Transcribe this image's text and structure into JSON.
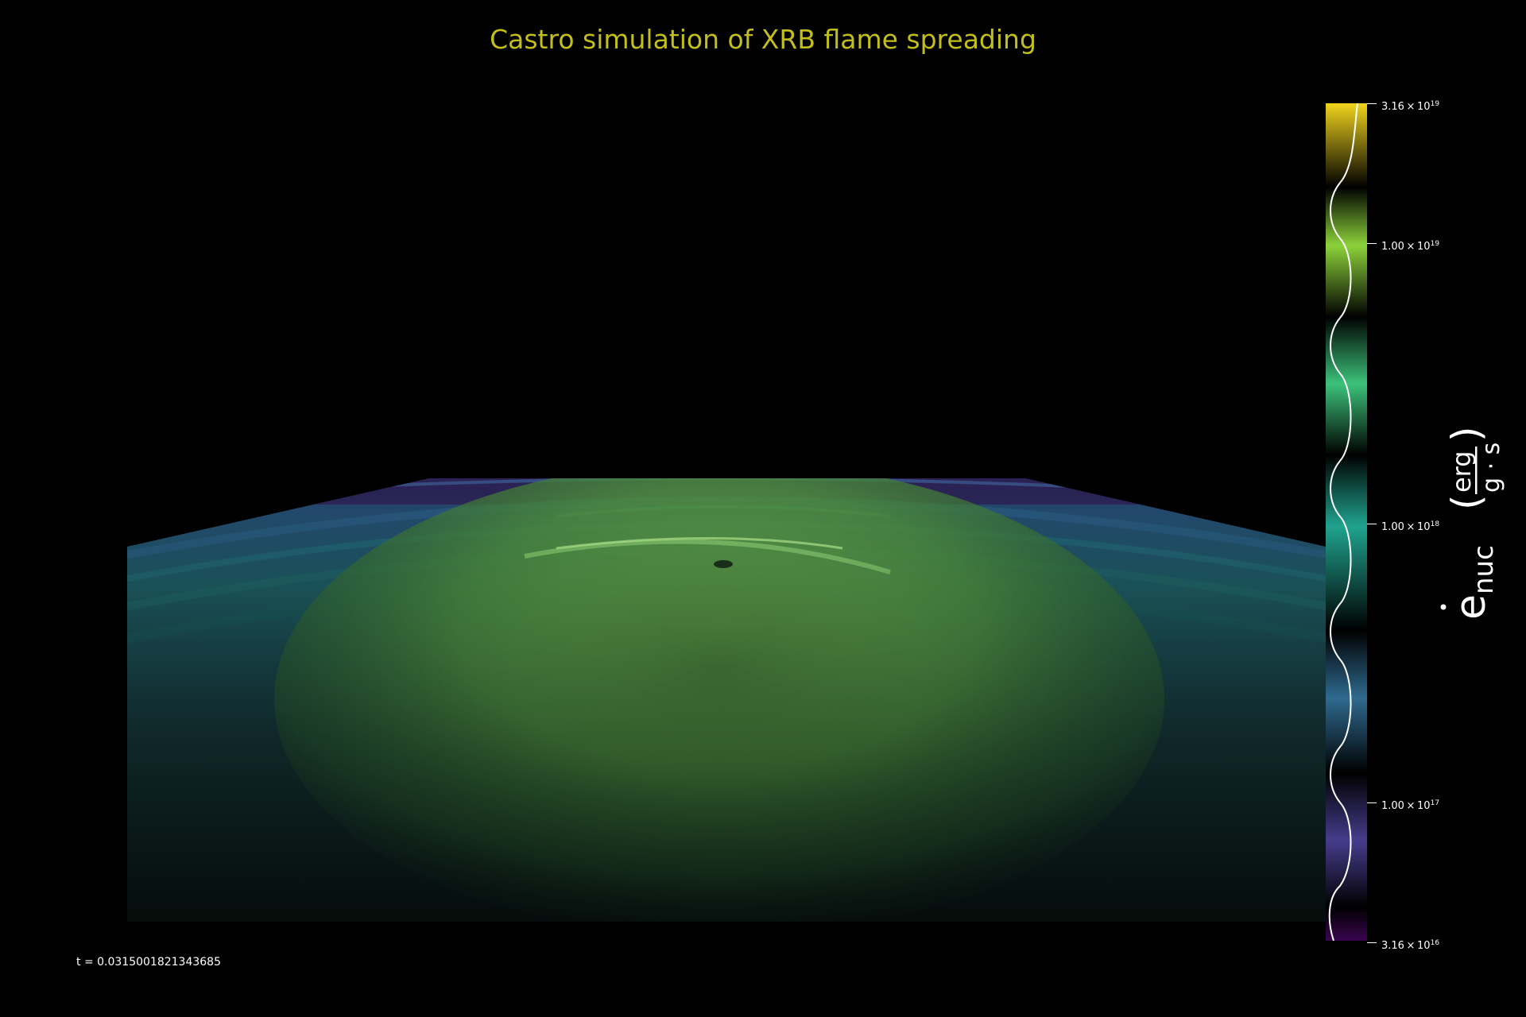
{
  "figure": {
    "title": "Castro simulation of XRB flame spreading",
    "timestamp": "t = 0.0315001821343685"
  },
  "colorbar": {
    "label": "ė_nuc (erg / g·s)",
    "label_symbol": "e",
    "label_subscript": "nuc",
    "label_unit_numerator": "erg",
    "label_unit_denominator": "g · s",
    "scale": "log",
    "colormap_colors": [
      "#3a0550",
      "#463c8c",
      "#2f6a8f",
      "#20a38f",
      "#3cc27a",
      "#8cd23a",
      "#f0d41c"
    ],
    "ticks": [
      {
        "mantissa": "3.16",
        "exponent": "19"
      },
      {
        "mantissa": "1.00",
        "exponent": "19"
      },
      {
        "mantissa": "1.00",
        "exponent": "18"
      },
      {
        "mantissa": "1.00",
        "exponent": "17"
      },
      {
        "mantissa": "3.16",
        "exponent": "16"
      }
    ]
  }
}
